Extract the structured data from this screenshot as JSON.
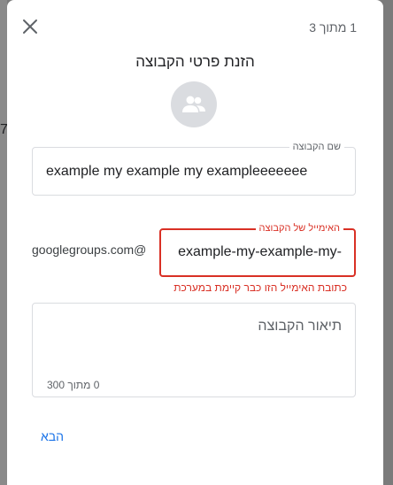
{
  "background": {
    "left_edge_digit": "7"
  },
  "dialog": {
    "step": "1 מתוך 3",
    "title": "הזנת פרטי הקבוצה",
    "close_icon": "close-icon",
    "avatar_icon": "group-icon",
    "name_field": {
      "label": "שם הקבוצה",
      "value": "example my example my exampleeeeeee"
    },
    "email_field": {
      "label": "האימייל של הקבוצה",
      "value": "example-my-example-my-",
      "domain": "googlegroups.com@",
      "error": "כתובת האימייל הזו כבר קיימת במערכת"
    },
    "description_field": {
      "placeholder": "תיאור הקבוצה",
      "counter": "0 מתוך 300"
    },
    "next_button": "הבא"
  },
  "colors": {
    "accent": "#1a73e8",
    "error": "#d93025"
  }
}
